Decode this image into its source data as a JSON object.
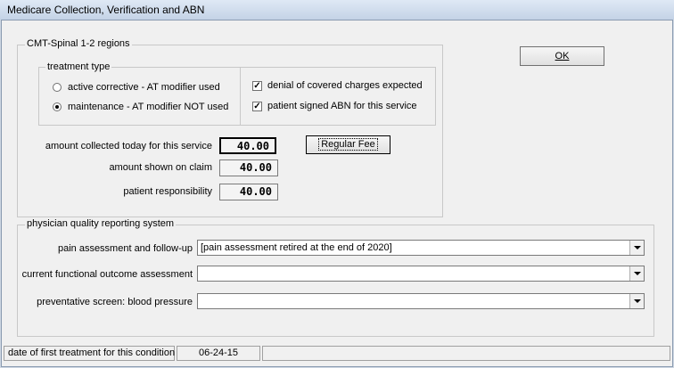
{
  "window": {
    "title": "Medicare Collection, Verification and ABN"
  },
  "cmt_group": {
    "label": "CMT-Spinal 1-2 regions",
    "treatment_type": {
      "label": "treatment type",
      "options": [
        {
          "label": "active corrective - AT modifier used",
          "selected": false
        },
        {
          "label": "maintenance - AT modifier NOT used",
          "selected": true
        }
      ]
    },
    "checkboxes": [
      {
        "label": "denial of covered charges expected",
        "checked": true
      },
      {
        "label": "patient signed ABN for this service",
        "checked": true
      }
    ],
    "amounts": {
      "collected_label": "amount collected today for this service",
      "collected_value": "40.00",
      "claim_label": "amount shown on claim",
      "claim_value": "40.00",
      "responsibility_label": "patient responsibility",
      "responsibility_value": "40.00"
    },
    "regular_fee_button": "Regular Fee"
  },
  "ok_button": "OK",
  "pqrs_group": {
    "label": "physician quality reporting system",
    "rows": [
      {
        "label": "pain assessment and follow-up",
        "value": "[pain assessment retired at the end of 2020]"
      },
      {
        "label": "current functional outcome assessment",
        "value": ""
      },
      {
        "label": "preventative screen: blood pressure",
        "value": ""
      }
    ]
  },
  "status": {
    "first_treatment_label": "date of first treatment for this condition",
    "first_treatment_date": "06-24-15"
  }
}
